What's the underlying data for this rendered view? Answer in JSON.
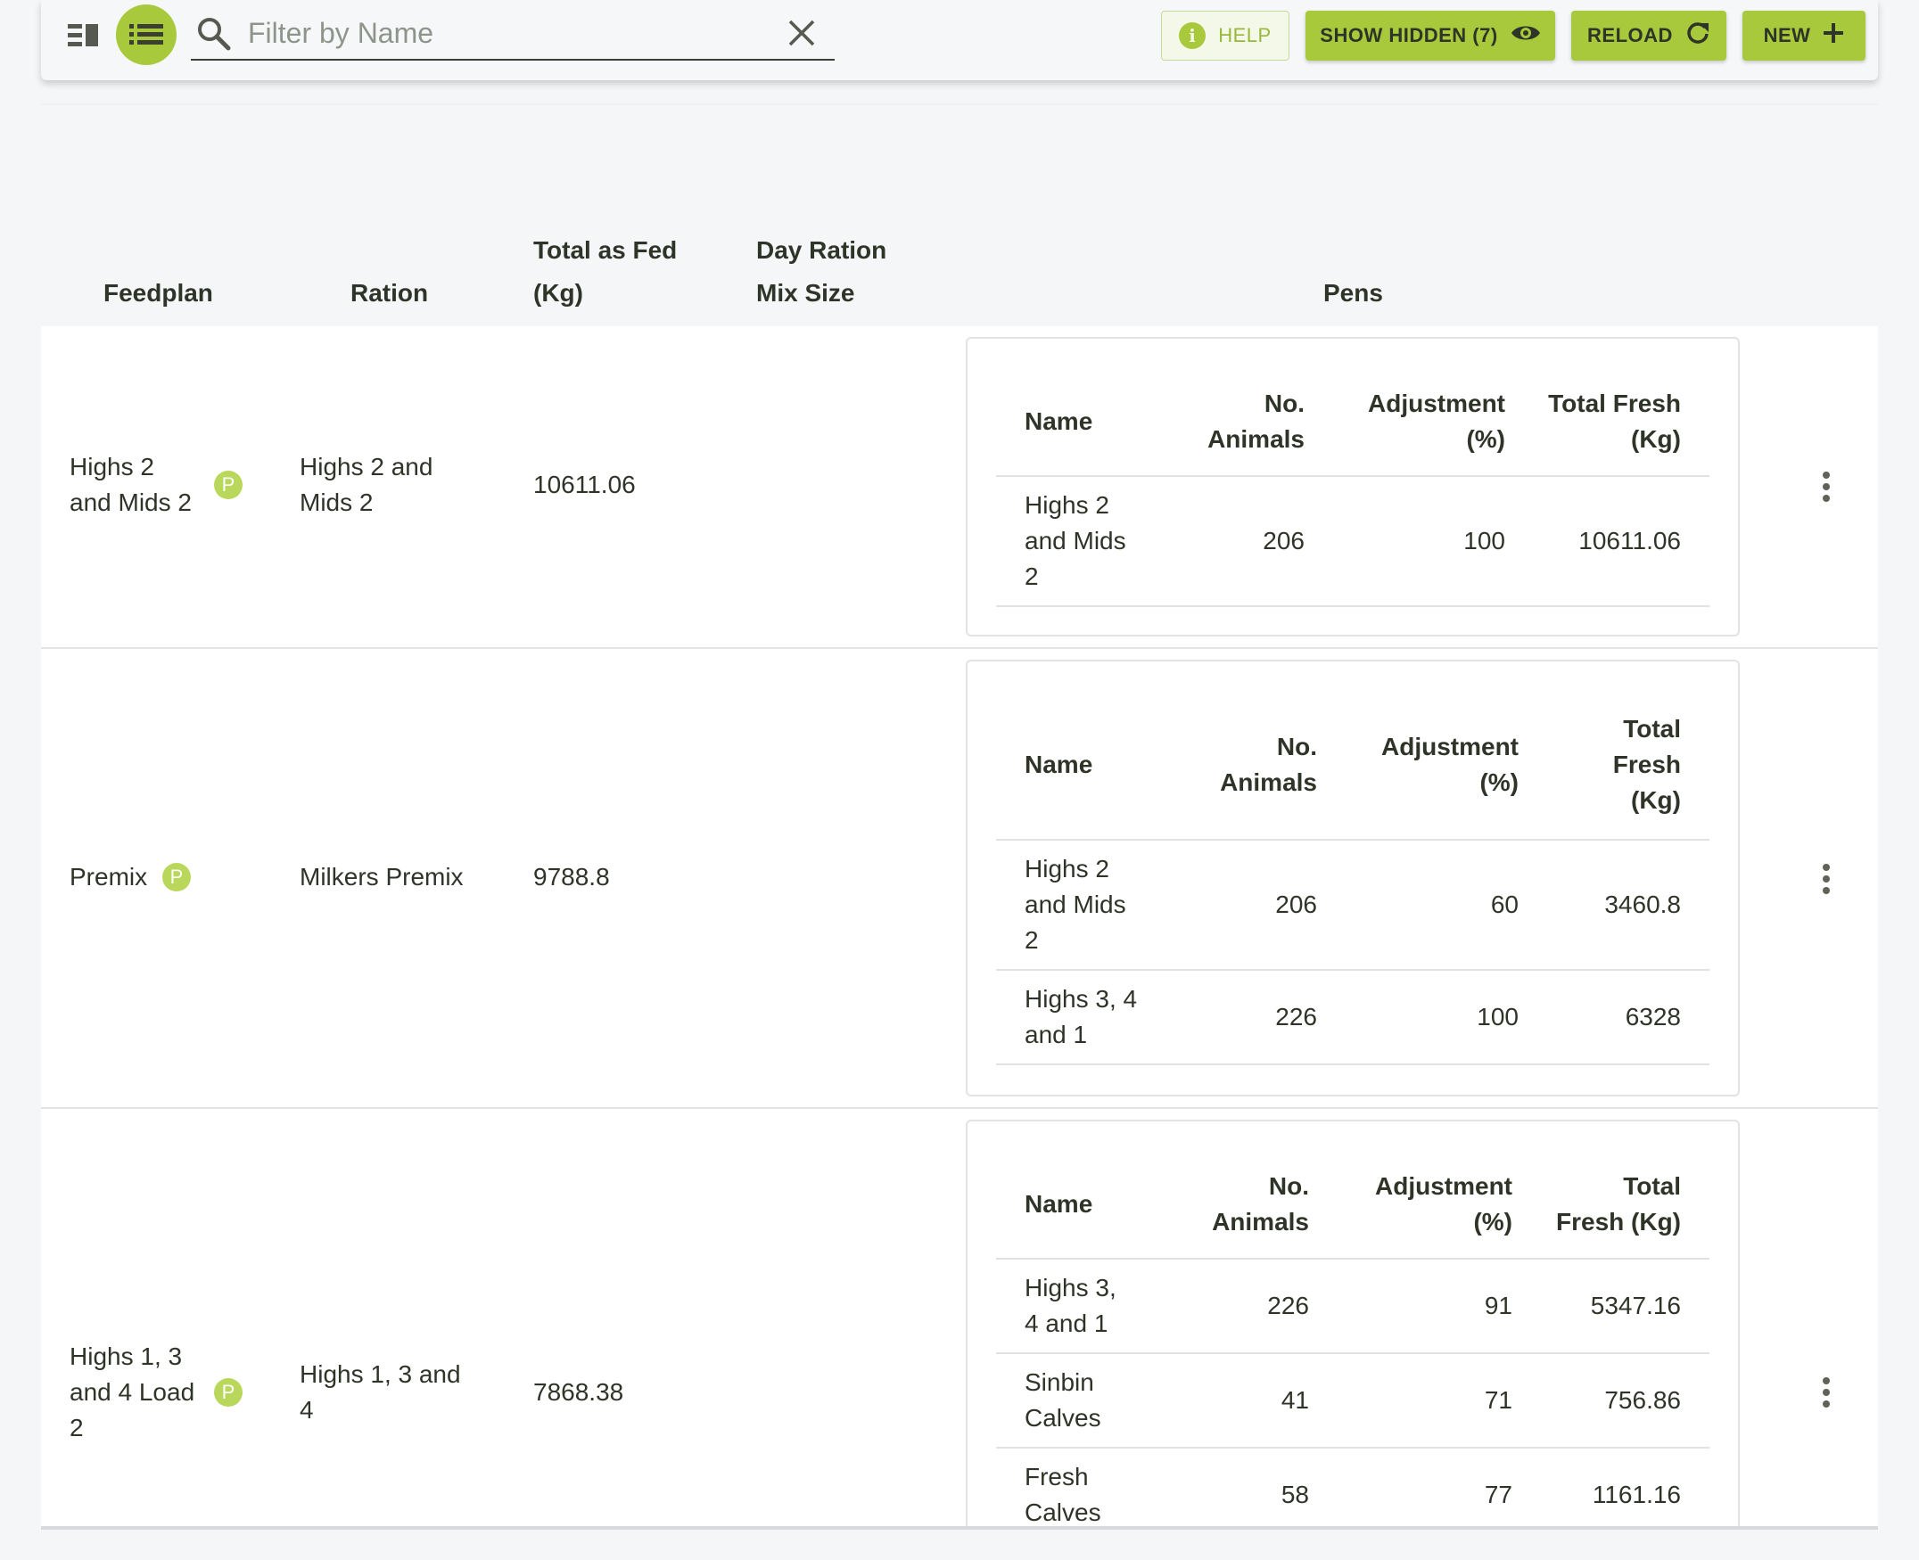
{
  "toolbar": {
    "search_placeholder": "Filter by Name",
    "help_label": "HELP",
    "show_hidden_label": "SHOW HIDDEN (7)",
    "reload_label": "RELOAD",
    "new_label": "NEW",
    "accent_color": "#a7c93b"
  },
  "table": {
    "headers": {
      "feedplan": "Feedplan",
      "ration": "Ration",
      "total_as_fed_1": "Total as Fed",
      "total_as_fed_2": "(Kg)",
      "day_ration_1": "Day Ration",
      "day_ration_2": "Mix Size",
      "pens": "Pens"
    },
    "badge_letter": "P",
    "rows": [
      {
        "feedplan_lines": [
          "Highs 2",
          "and Mids 2"
        ],
        "ration_lines": [
          "Highs 2 and",
          "Mids 2"
        ],
        "total_as_fed": "10611.06",
        "pens_headers": {
          "name": "Name",
          "no_animals": [
            "No.",
            "Animals"
          ],
          "adjustment": [
            "Adjustment",
            "(%)"
          ],
          "total_fresh": [
            "Total Fresh",
            "(Kg)"
          ]
        },
        "pens": [
          {
            "name": [
              "Highs 2",
              "and Mids",
              "2"
            ],
            "animals": "206",
            "adjustment": "100",
            "total_fresh": "10611.06"
          }
        ]
      },
      {
        "feedplan_lines": [
          "Premix"
        ],
        "ration_lines": [
          "Milkers Premix"
        ],
        "total_as_fed": "9788.8",
        "pens_headers": {
          "name": "Name",
          "no_animals": [
            "No.",
            "Animals"
          ],
          "adjustment": [
            "Adjustment",
            "(%)"
          ],
          "total_fresh": [
            "Total",
            "Fresh",
            "(Kg)"
          ]
        },
        "pens": [
          {
            "name": [
              "Highs 2",
              "and Mids",
              "2"
            ],
            "animals": "206",
            "adjustment": "60",
            "total_fresh": "3460.8"
          },
          {
            "name": [
              "Highs 3, 4",
              "and 1"
            ],
            "animals": "226",
            "adjustment": "100",
            "total_fresh": "6328"
          }
        ]
      },
      {
        "feedplan_lines": [
          "Highs 1, 3",
          "and 4 Load",
          "2"
        ],
        "ration_lines": [
          "Highs 1, 3 and",
          "4"
        ],
        "total_as_fed": "7868.38",
        "pens_headers": {
          "name": "Name",
          "no_animals": [
            "No.",
            "Animals"
          ],
          "adjustment": [
            "Adjustment",
            "(%)"
          ],
          "total_fresh": [
            "Total",
            "Fresh (Kg)"
          ]
        },
        "pens": [
          {
            "name": [
              "Highs 3,",
              "4 and 1"
            ],
            "animals": "226",
            "adjustment": "91",
            "total_fresh": "5347.16"
          },
          {
            "name": [
              "Sinbin",
              "Calves"
            ],
            "animals": "41",
            "adjustment": "71",
            "total_fresh": "756.86"
          },
          {
            "name": [
              "Fresh",
              "Calves"
            ],
            "animals": "58",
            "adjustment": "77",
            "total_fresh": "1161.16"
          }
        ]
      }
    ]
  }
}
